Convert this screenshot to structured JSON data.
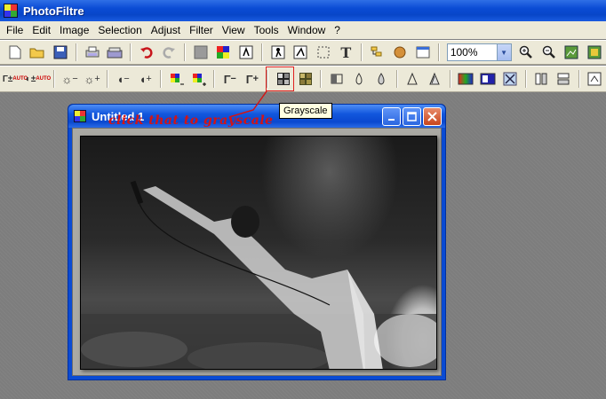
{
  "app": {
    "title": "PhotoFiltre"
  },
  "menu": [
    "File",
    "Edit",
    "Image",
    "Selection",
    "Adjust",
    "Filter",
    "View",
    "Tools",
    "Window",
    "?"
  ],
  "toolbar1": {
    "zoom_value": "100%",
    "icons": [
      "new-icon",
      "open-icon",
      "save-icon",
      "print-icon",
      "scanner-icon",
      "undo-icon",
      "redo-icon",
      "transparency-icon",
      "color-palette-icon",
      "automation-icon",
      "batch-icon",
      "selection-icon",
      "rect-selection-icon",
      "text-icon",
      "explorer-icon",
      "plugin-icon",
      "window-icon",
      "zoom-in-icon",
      "zoom-out-icon",
      "fit-image-icon",
      "actual-size-icon"
    ]
  },
  "toolbar2": {
    "auto_label": "AUTO",
    "grayscale_tooltip": "Grayscale"
  },
  "annotation": {
    "text": "click that to grayscale"
  },
  "child_window": {
    "title": "Untitled 1"
  },
  "colors": {
    "xp_blue": "#0a4bd4",
    "annotation_red": "#d41414",
    "toolbar_bg": "#ece9d8"
  }
}
